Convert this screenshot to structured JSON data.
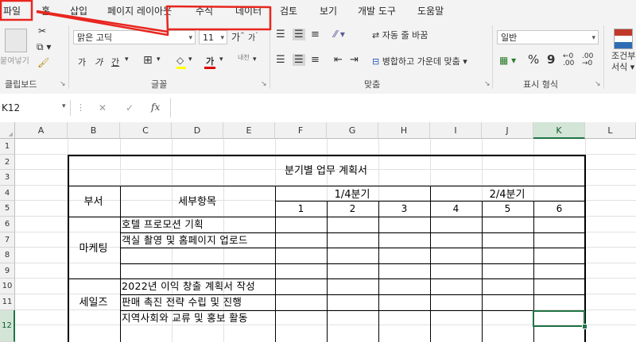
{
  "tabs": [
    "파일",
    "홈",
    "삽입",
    "페이지 레이아웃",
    "수식",
    "데이터",
    "검토",
    "보기",
    "개발 도구",
    "도움말"
  ],
  "ribbon": {
    "clipboard": {
      "paste_label": "붙여넣기",
      "group_label": "클립보드"
    },
    "font": {
      "font_name": "맑은 고딕",
      "font_size": "11",
      "grow": "가",
      "shrink": "가",
      "bold": "가",
      "italic": "가",
      "underline": "간",
      "font_color": "가",
      "phonetic": "내천",
      "group_label": "글꼴"
    },
    "alignment": {
      "wrap_text": "자동 줄 바꿈",
      "merge_center": "병합하고 가운데 맞춤",
      "group_label": "맞춤"
    },
    "number": {
      "format": "일반",
      "percent": "%",
      "comma": "9",
      "group_label": "표시 형식"
    },
    "styles": {
      "conditional_line1": "조건부",
      "conditional_line2": "서식"
    }
  },
  "formula_bar": {
    "name_box": "K12",
    "cancel": "✕",
    "enter": "✓",
    "fx": "fx",
    "value": ""
  },
  "columns": [
    "A",
    "B",
    "C",
    "D",
    "E",
    "F",
    "G",
    "H",
    "I",
    "J",
    "K",
    "L"
  ],
  "rows": [
    "1",
    "2",
    "3",
    "4",
    "5",
    "6",
    "7",
    "8",
    "9",
    "10",
    "11",
    "12"
  ],
  "sheet": {
    "title": "분기별 업무 계획서",
    "dept_header": "부서",
    "item_header": "세부항목",
    "q1": "1/4분기",
    "q2": "2/4분기",
    "months": [
      "1",
      "2",
      "3",
      "4",
      "5",
      "6"
    ],
    "marketing": "마케팅",
    "sales": "세일즈",
    "items": [
      "호텔 프로모션 기획",
      "객실 촬영 및 홈페이지 업로드",
      "",
      "",
      "2022년 이익 창출 계획서 작성",
      "판매 촉진 전략 수립 및 진행",
      "지역사회와 교류 및 홍보 활동"
    ]
  },
  "colors": {
    "accent_green": "#217346",
    "annotation_red": "#e8261f"
  }
}
